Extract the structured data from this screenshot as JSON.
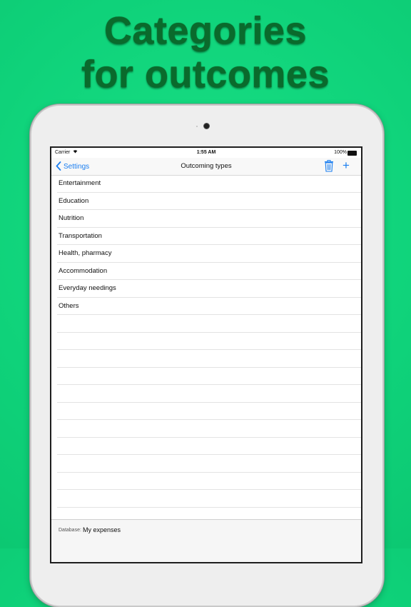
{
  "headline": {
    "line1": "Categories",
    "line2": "for outcomes"
  },
  "status_bar": {
    "carrier": "Carrier",
    "time": "1:55 AM",
    "battery": "100%"
  },
  "nav": {
    "back_label": "Settings",
    "title": "Outcoming types"
  },
  "categories": [
    "Entertainment",
    "Education",
    "Nutrition",
    "Transportation",
    "Health, pharmacy",
    "Accommodation",
    "Everyday needings",
    "Others"
  ],
  "footer": {
    "database_label": "Database:",
    "database_value": "My expenses"
  },
  "colors": {
    "background": "#0fd97a",
    "headline": "#0a6a2c",
    "accent": "#1a7ef0"
  }
}
